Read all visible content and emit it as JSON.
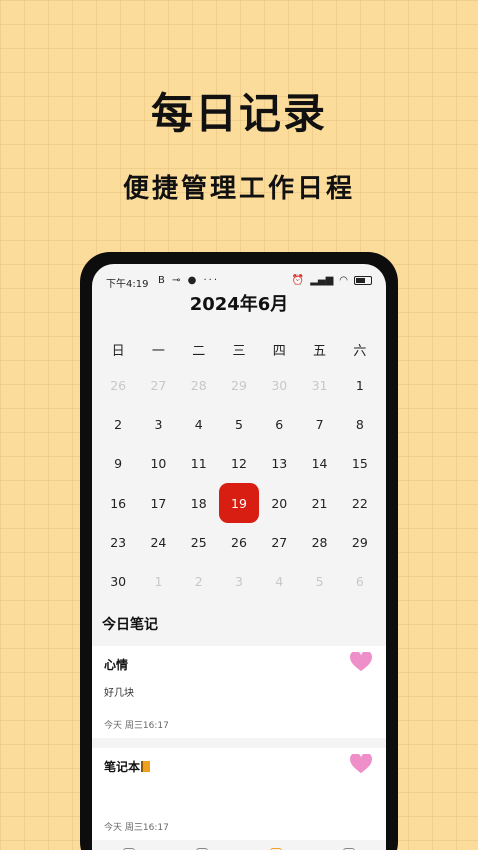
{
  "promo": {
    "title": "每日记录",
    "subtitle": "便捷管理工作日程"
  },
  "statusbar": {
    "time": "下午4:19",
    "left_icons": "B ⊸ ● ···",
    "right_icons": [
      "alarm-icon",
      "signal-icon",
      "wifi-icon",
      "battery-icon"
    ]
  },
  "calendar": {
    "month_title": "2024年6月",
    "weekdays": [
      "日",
      "一",
      "二",
      "三",
      "四",
      "五",
      "六"
    ],
    "days": [
      {
        "d": "26",
        "muted": true
      },
      {
        "d": "27",
        "muted": true
      },
      {
        "d": "28",
        "muted": true
      },
      {
        "d": "29",
        "muted": true
      },
      {
        "d": "30",
        "muted": true
      },
      {
        "d": "31",
        "muted": true
      },
      {
        "d": "1"
      },
      {
        "d": "2"
      },
      {
        "d": "3"
      },
      {
        "d": "4"
      },
      {
        "d": "5"
      },
      {
        "d": "6"
      },
      {
        "d": "7"
      },
      {
        "d": "8"
      },
      {
        "d": "9"
      },
      {
        "d": "10"
      },
      {
        "d": "11"
      },
      {
        "d": "12"
      },
      {
        "d": "13"
      },
      {
        "d": "14"
      },
      {
        "d": "15"
      },
      {
        "d": "16"
      },
      {
        "d": "17"
      },
      {
        "d": "18"
      },
      {
        "d": "19",
        "selected": true
      },
      {
        "d": "20"
      },
      {
        "d": "21"
      },
      {
        "d": "22"
      },
      {
        "d": "23"
      },
      {
        "d": "24"
      },
      {
        "d": "25"
      },
      {
        "d": "26"
      },
      {
        "d": "27"
      },
      {
        "d": "28"
      },
      {
        "d": "29"
      },
      {
        "d": "30"
      },
      {
        "d": "1",
        "muted": true
      },
      {
        "d": "2",
        "muted": true
      },
      {
        "d": "3",
        "muted": true
      },
      {
        "d": "4",
        "muted": true
      },
      {
        "d": "5",
        "muted": true
      },
      {
        "d": "6",
        "muted": true
      }
    ],
    "selected_color": "#d81e12"
  },
  "notes": {
    "section_title": "今日笔记",
    "items": [
      {
        "title": "心情",
        "body": "好几块",
        "date": "今天 周三16:17",
        "heart_color": "#ef8fc9"
      },
      {
        "title": "笔记本",
        "body": "",
        "date": "今天 周三16:17",
        "heart_color": "#ef8fc9"
      }
    ]
  },
  "colors": {
    "background": "#fbdc9a",
    "phone_frame": "#0d0d0d"
  }
}
